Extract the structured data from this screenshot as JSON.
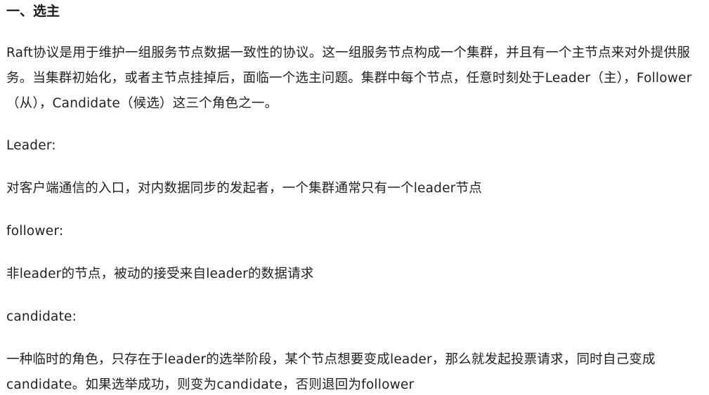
{
  "heading": "一、选主",
  "intro": "Raft协议是用于维护一组服务节点数据一致性的协议。这一组服务节点构成一个集群，并且有一个主节点来对外提供服务。当集群初始化，或者主节点挂掉后，面临一个选主问题。集群中每个节点，任意时刻处于Leader（主），Follower（从），Candidate（候选）这三个角色之一。",
  "roles": [
    {
      "term": "Leader:",
      "description": "对客户端通信的入口，对内数据同步的发起者，一个集群通常只有一个leader节点"
    },
    {
      "term": "follower:",
      "description": "非leader的节点，被动的接受来自leader的数据请求"
    },
    {
      "term": "candidate:",
      "description": "一种临时的角色，只存在于leader的选举阶段，某个节点想要变成leader，那么就发起投票请求，同时自己变成candidate。如果选举成功，则变为candidate，否则退回为follower"
    }
  ]
}
